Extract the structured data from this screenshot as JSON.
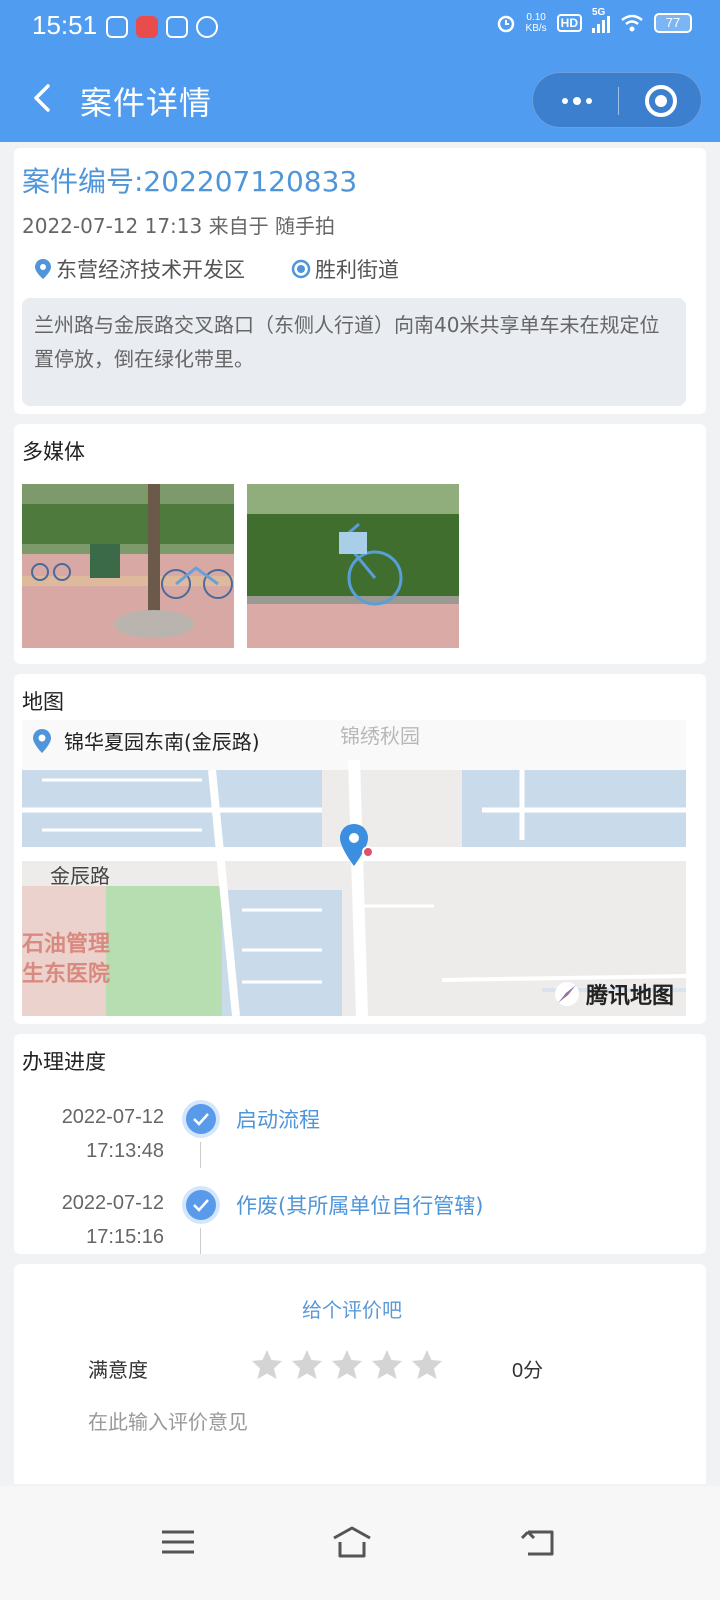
{
  "status_bar": {
    "time": "15:51",
    "net_speed_value": "0.10",
    "net_speed_unit": "KB/s",
    "hd_label": "HD",
    "network_label": "5G",
    "battery_level": "77"
  },
  "nav": {
    "title": "案件详情"
  },
  "case": {
    "number_text": "案件编号:202207120833",
    "meta": "2022-07-12 17:13 来自于 随手拍",
    "district": "东营经济技术开发区",
    "street": "胜利街道",
    "description": "兰州路与金辰路交叉路口（东侧人行道）向南40米共享单车未在规定位置停放，倒在绿化带里。"
  },
  "media": {
    "title": "多媒体"
  },
  "map": {
    "title": "地图",
    "location_name": "锦华夏园东南(金辰路)",
    "labels": {
      "jinxiu": "锦绣秋园",
      "jinchen": "金辰路",
      "shiyou": "石油管理",
      "hospital": "生东医院"
    },
    "provider": "腾讯地图"
  },
  "progress": {
    "title": "办理进度",
    "steps": [
      {
        "date": "2022-07-12",
        "time": "17:13:48",
        "label": "启动流程"
      },
      {
        "date": "2022-07-12",
        "time": "17:15:16",
        "label": "作废(其所属单位自行管辖)"
      }
    ]
  },
  "rating": {
    "prompt": "给个评价吧",
    "satisfaction_label": "满意度",
    "stars_total": 5,
    "stars_filled": 0,
    "score": "0分",
    "comment_placeholder": "在此输入评价意见"
  },
  "colors": {
    "header_bg": "#4f9cf0",
    "accent_blue": "#4f95d9",
    "star_gray": "#d4d4d4"
  }
}
